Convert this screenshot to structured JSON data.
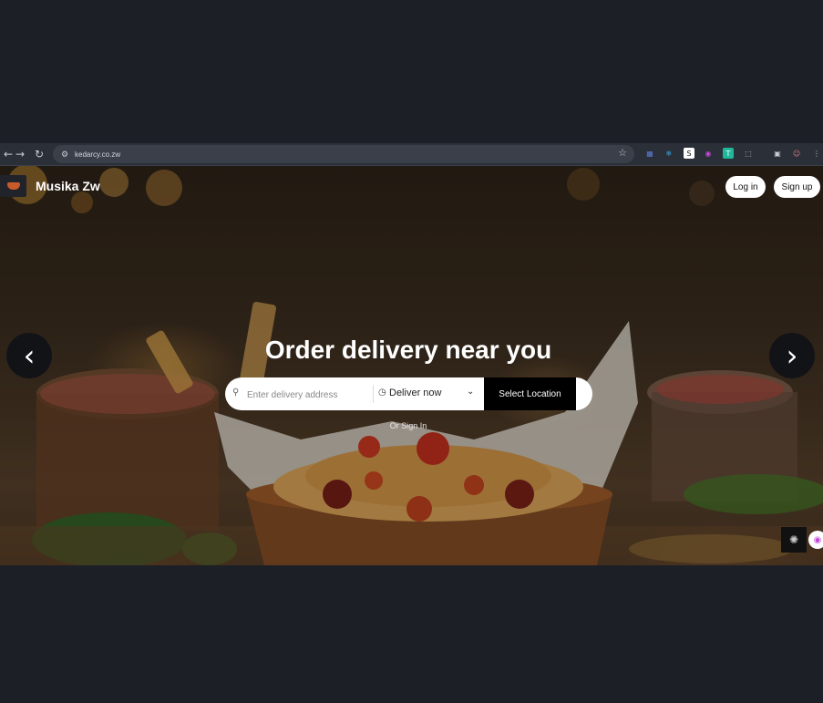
{
  "browser": {
    "url": "kedarcy.co.zw",
    "nav_back_icon": "←",
    "nav_forward_icon": "→",
    "nav_reload_icon": "↻",
    "site_info_icon": "⚙",
    "bookmark_icon": "☆",
    "extensions": [
      {
        "name": "ext-grid-icon",
        "glyph": "▦",
        "color": "#5b7bd5"
      },
      {
        "name": "ext-globe-icon",
        "glyph": "❄",
        "color": "#3aa0d8"
      },
      {
        "name": "ext-s-icon",
        "glyph": "S",
        "color": "#ffffff"
      },
      {
        "name": "ext-brain-icon",
        "glyph": "◉",
        "color": "#c04bd6"
      },
      {
        "name": "ext-translate-icon",
        "glyph": "T",
        "color": "#1fb89b"
      },
      {
        "name": "ext-puzzle-icon",
        "glyph": "⬚",
        "color": "#c9ccd3"
      },
      {
        "name": "ext-tab-icon",
        "glyph": "▣",
        "color": "#c9ccd3"
      },
      {
        "name": "profile-avatar-icon",
        "glyph": "☺",
        "color": "#e07a8a"
      },
      {
        "name": "menu-kebab-icon",
        "glyph": "⋮",
        "color": "#c9ccd3"
      }
    ]
  },
  "header": {
    "brand": "Musika Zw",
    "login_label": "Log in",
    "signup_label": "Sign up"
  },
  "hero": {
    "title": "Order delivery near you",
    "address_placeholder": "Enter delivery address",
    "deliver_option": "Deliver now",
    "select_location_label": "Select Location",
    "signin_text": "Or Sign In",
    "prev_arrow": "‹",
    "next_arrow": "›"
  },
  "colors": {
    "page_bg": "#1c1f26",
    "accent_button": "#000000"
  }
}
